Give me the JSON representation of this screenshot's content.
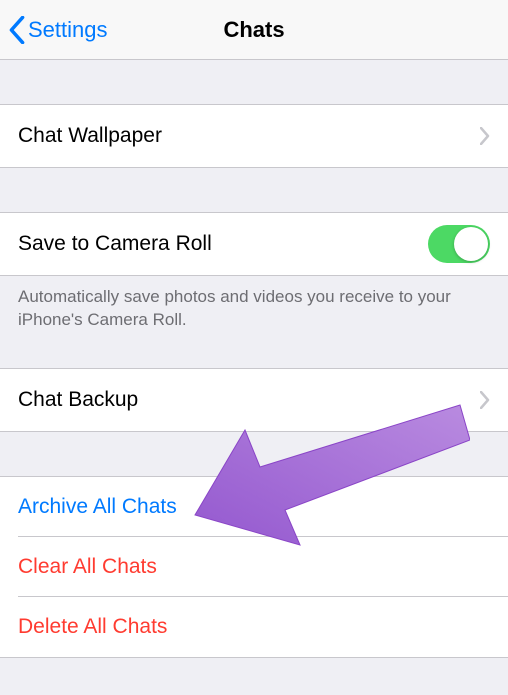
{
  "nav": {
    "back_label": "Settings",
    "title": "Chats"
  },
  "rows": {
    "wallpaper": "Chat Wallpaper",
    "save_camera_roll": "Save to Camera Roll",
    "save_camera_roll_footer": "Automatically save photos and videos you receive to your iPhone's Camera Roll.",
    "chat_backup": "Chat Backup",
    "archive_all": "Archive All Chats",
    "clear_all": "Clear All Chats",
    "delete_all": "Delete All Chats"
  },
  "toggle": {
    "save_camera_roll_on": true
  },
  "colors": {
    "ios_blue": "#007aff",
    "ios_red": "#ff3b30",
    "ios_green": "#4cd964",
    "annotation_purple": "#a064d8"
  }
}
